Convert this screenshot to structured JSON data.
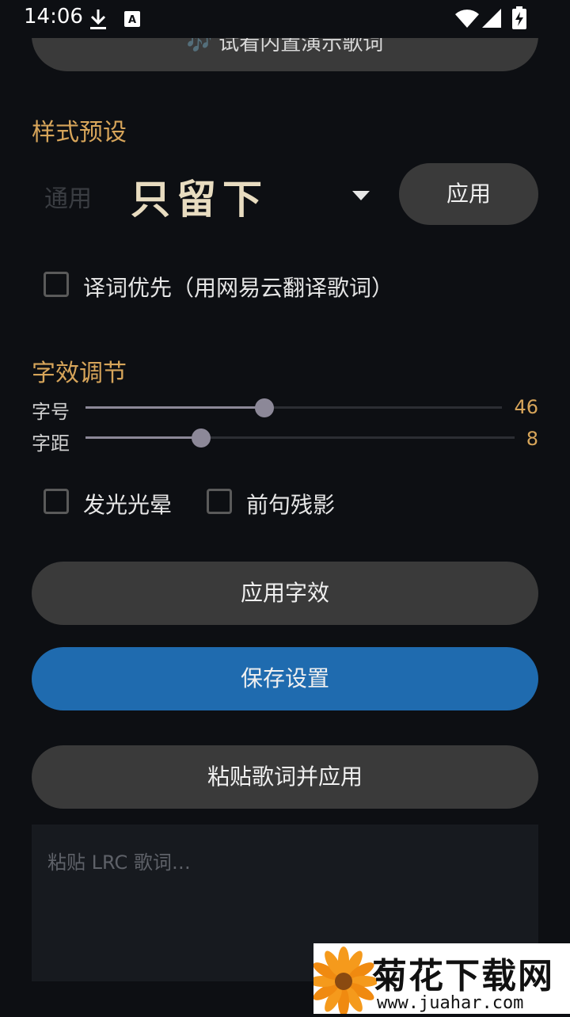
{
  "status_bar": {
    "time": "14:06",
    "icons": [
      "download-icon",
      "a11y-badge-icon",
      "wifi-icon",
      "signal-icon",
      "battery-charging-icon"
    ]
  },
  "top_button": {
    "label": "🎶 试看内置演示歌词"
  },
  "style_preset": {
    "title": "样式预设",
    "dropdown_hint": "通用",
    "preview_text": "只留下",
    "apply_label": "应用"
  },
  "translate_pref": {
    "label": "译词优先（用网易云翻译歌词）",
    "checked": false
  },
  "text_effects": {
    "title": "字效调节",
    "font_size": {
      "label": "字号",
      "value": "46",
      "fraction": 0.43
    },
    "letter_spacing": {
      "label": "字距",
      "value": "8",
      "fraction": 0.27
    },
    "glow": {
      "label": "发光光晕",
      "checked": false
    },
    "afterimage": {
      "label": "前句残影",
      "checked": false
    },
    "apply_label": "应用字效"
  },
  "save_label": "保存设置",
  "paste_apply_label": "粘贴歌词并应用",
  "lrc_input": {
    "placeholder": "粘贴 LRC 歌词…",
    "value": ""
  },
  "watermark": {
    "name": "菊花下载网",
    "url": "www.juahar.com"
  },
  "colors": {
    "accent": "#d7a55a",
    "primary": "#1f6baf",
    "background": "#0d0f13"
  }
}
